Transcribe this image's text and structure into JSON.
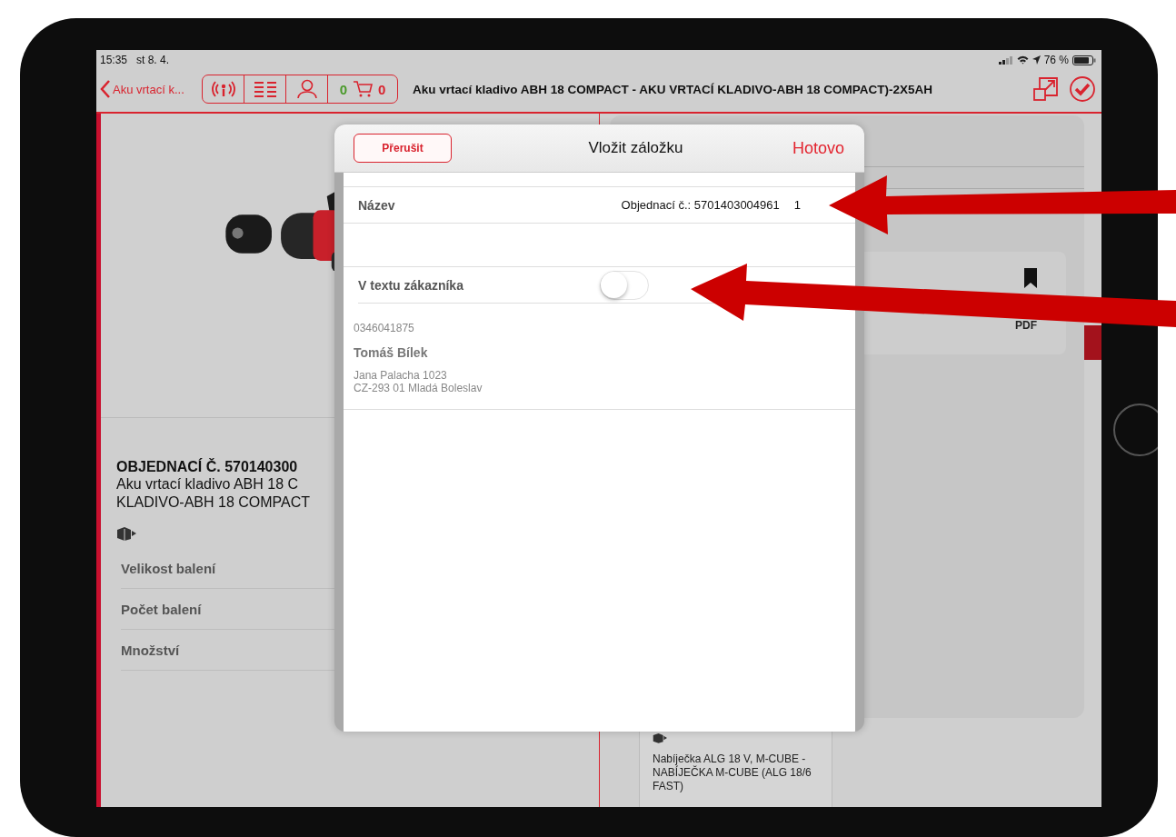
{
  "status_bar": {
    "time": "15:35",
    "date": "st 8. 4.",
    "battery": "76 %"
  },
  "nav": {
    "back": "Aku vrtací k...",
    "cart_count": "0",
    "cart_total": "0",
    "title": "Aku vrtací kladivo ABH 18 COMPACT - AKU VRTACÍ KLADIVO-ABH 18 COMPACT)-2X5AH"
  },
  "product": {
    "heading": "OBJEDNACÍ Č. 570140300",
    "description": [
      "Aku vrtací kladivo ABH 18 C",
      "KLADIVO-ABH 18 COMPACT"
    ],
    "rows": [
      "Velikost balení",
      "Počet balení",
      "Množství"
    ]
  },
  "related_item": {
    "text": "Nabíječka ALG 18 V, M-CUBE - NABÍJEČKA M-CUBE (ALG 18/6 FAST)"
  },
  "popover": {
    "document_label": "PDF"
  },
  "modal": {
    "cancel": "Přerušit",
    "title": "Vložit záložku",
    "done": "Hotovo",
    "name_row": {
      "label": "Název",
      "value": "Objednací č.: 5701403004961",
      "quantity": "1"
    },
    "toggle": {
      "label": "V textu zákazníka",
      "on": false
    },
    "customer": {
      "phone": "0346041875",
      "name": "Tomáš Bílek",
      "address": [
        "Jana Palacha  1023",
        "CZ-293 01 Mladá Boleslav"
      ]
    }
  }
}
